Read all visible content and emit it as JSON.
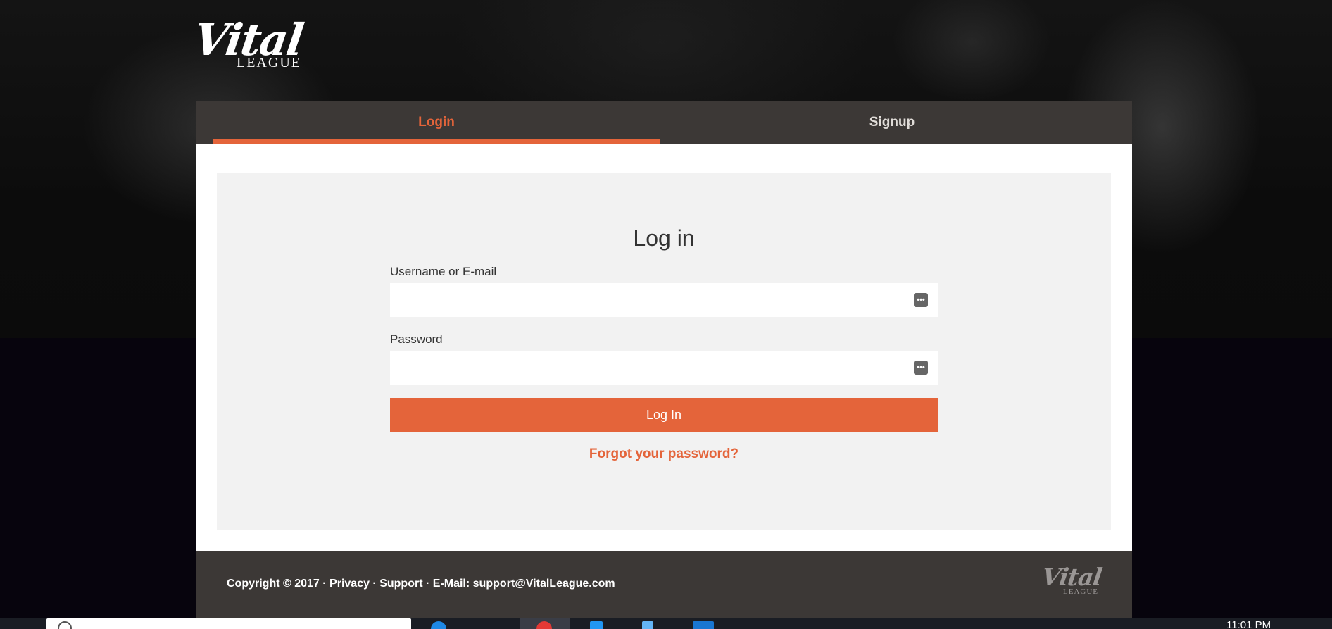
{
  "brand": {
    "name_top": "Vital",
    "name_bottom": "LEAGUE"
  },
  "tabs": [
    {
      "label": "Login",
      "active": true
    },
    {
      "label": "Signup",
      "active": false
    }
  ],
  "form": {
    "title": "Log in",
    "username_label": "Username or E-mail",
    "username_value": "",
    "password_label": "Password",
    "password_value": "",
    "submit_label": "Log In",
    "forgot_label": "Forgot your password?"
  },
  "footer": {
    "copyright": "Copyright © 2017 · ",
    "privacy": "Privacy",
    "sep1": " · ",
    "support": "Support",
    "sep2": " · E-Mail: ",
    "email": "support@VitalLeague.com"
  },
  "taskbar": {
    "clock": "11:01 PM"
  },
  "colors": {
    "accent": "#e4643a",
    "dark_panel": "#3c3836",
    "form_bg": "#f2f2f2"
  },
  "icons": {
    "field_autofill": "more-dots-icon",
    "search": "search-icon"
  }
}
